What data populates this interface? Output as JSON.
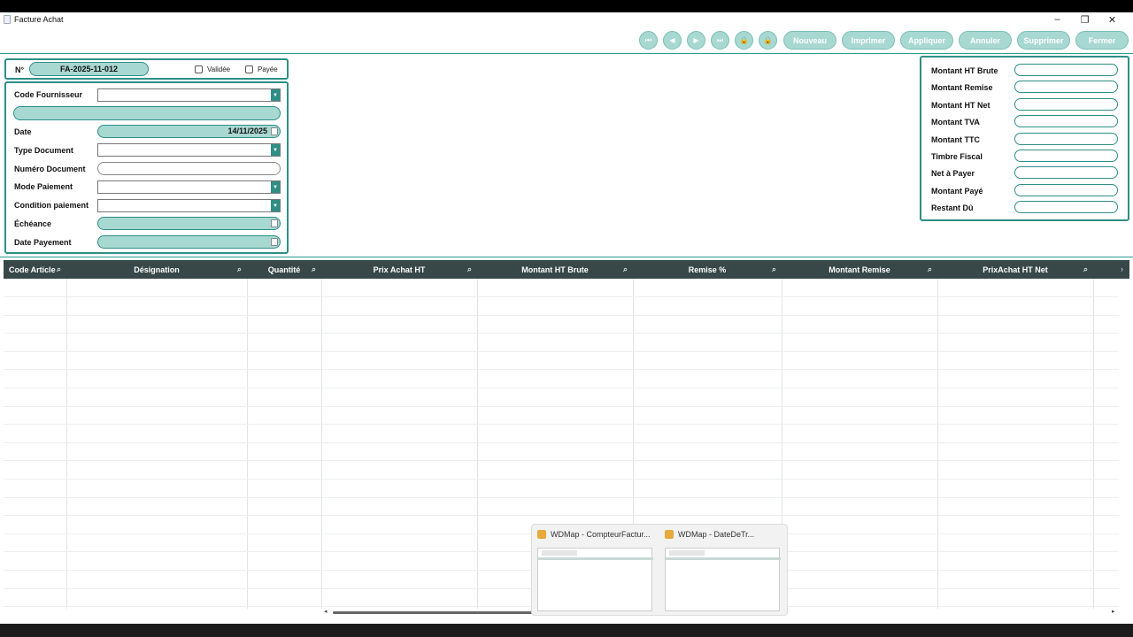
{
  "window": {
    "title": "Facture Achat"
  },
  "window_controls": {
    "minimize": "–",
    "maximize": "❐",
    "close": "✕"
  },
  "toolbar": {
    "nav": [
      "⏮",
      "◀",
      "▶",
      "⏭",
      "🔒",
      "🔒"
    ],
    "actions": [
      "Nouveau",
      "Imprimer",
      "Appliquer",
      "Annuler",
      "Supprimer",
      "Fermer"
    ]
  },
  "header": {
    "num_label": "N°",
    "num_value": "FA-2025-11-012",
    "validee_label": "Validée",
    "payee_label": "Payée"
  },
  "form": {
    "code_fournisseur": "Code Fournisseur",
    "date": "Date",
    "date_value": "14/11/2025",
    "type_document": "Type Document",
    "numero_document": "Numéro Document",
    "mode_paiement": "Mode Paiement",
    "condition_paiement": "Condition paiement",
    "echeance": "Échéance",
    "date_payement": "Date Payement"
  },
  "totals": [
    "Montant HT Brute",
    "Montant Remise",
    "Montant HT Net",
    "Montant TVA",
    "Montant TTC",
    "Timbre Fiscal",
    "Net à Payer",
    "Montant Payé",
    "Restant Dû"
  ],
  "grid": {
    "columns": [
      "Code Article",
      "Désignation",
      "Quantité",
      "Prix Achat HT",
      "Montant HT Brute",
      "Remise %",
      "Montant Remise",
      "PrixAchat HT Net"
    ]
  },
  "taskbar_thumbs": [
    {
      "title": "WDMap - CompteurFactur..."
    },
    {
      "title": "WDMap - DateDeTr..."
    }
  ]
}
